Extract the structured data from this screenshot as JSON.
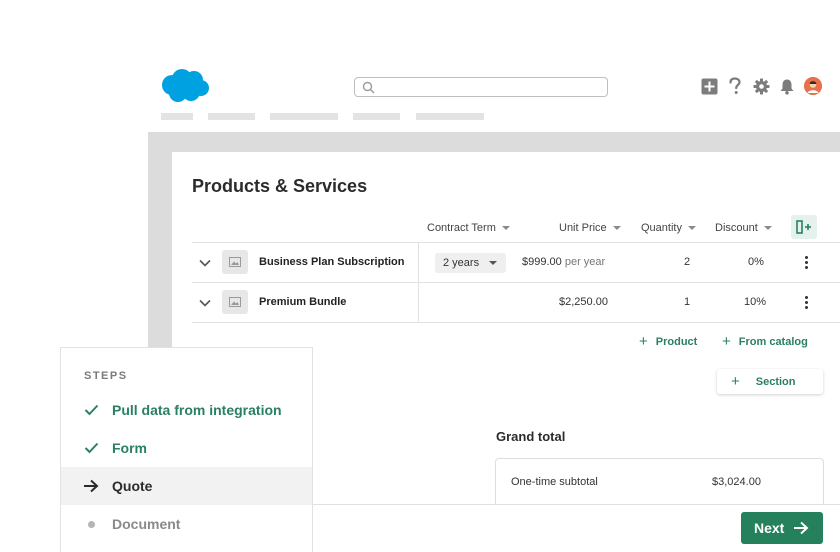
{
  "search": {
    "value": "",
    "placeholder": ""
  },
  "brand_color": "#00A1E0",
  "accent_color": "#25815C",
  "header": {
    "icons": [
      "plus-square-icon",
      "help-icon",
      "gear-icon",
      "bell-icon",
      "avatar"
    ]
  },
  "section": {
    "title": "Products & Services"
  },
  "table": {
    "columns": [
      {
        "label": "Contract Term"
      },
      {
        "label": "Unit Price"
      },
      {
        "label": "Quantity"
      },
      {
        "label": "Discount"
      }
    ],
    "rows": [
      {
        "name": "Business Plan Subscription",
        "term": "2 years",
        "price": "$999.00",
        "price_suffix": "per year",
        "quantity": "2",
        "discount": "0%"
      },
      {
        "name": "Premium Bundle",
        "term": "",
        "price": "$2,250.00",
        "price_suffix": "",
        "quantity": "1",
        "discount": "10%"
      }
    ]
  },
  "actions": {
    "add_product": "Product",
    "add_from_catalog": "From catalog",
    "add_section": "Section"
  },
  "totals": {
    "heading": "Grand total",
    "one_time_label": "One-time subtotal",
    "one_time_value": "$3,024.00"
  },
  "steps": {
    "heading": "STEPS",
    "items": [
      {
        "label": "Pull data from integration",
        "status": "done"
      },
      {
        "label": "Form",
        "status": "done"
      },
      {
        "label": "Quote",
        "status": "active"
      },
      {
        "label": "Document",
        "status": "pending"
      }
    ]
  },
  "footer": {
    "next_label": "Next"
  }
}
